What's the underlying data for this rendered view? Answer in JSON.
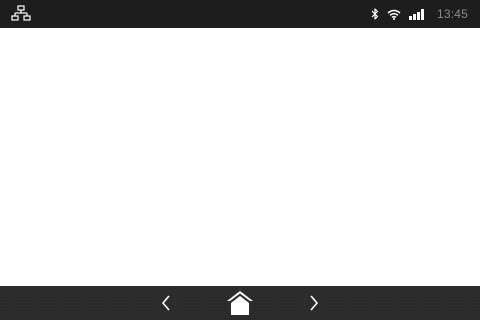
{
  "status_bar": {
    "left_icon": "network-icon",
    "icons": [
      "bluetooth-icon",
      "wifi-icon",
      "signal-icon"
    ],
    "time": "13:45"
  },
  "nav_bar": {
    "buttons": [
      "back-icon",
      "home-icon",
      "forward-icon"
    ]
  },
  "colors": {
    "status_bar_bg": "#1d1d1d",
    "nav_bar_bg": "#2b2b2b",
    "content_bg": "#ffffff",
    "icon_color": "#ffffff",
    "clock_color": "#8a8a8a"
  }
}
